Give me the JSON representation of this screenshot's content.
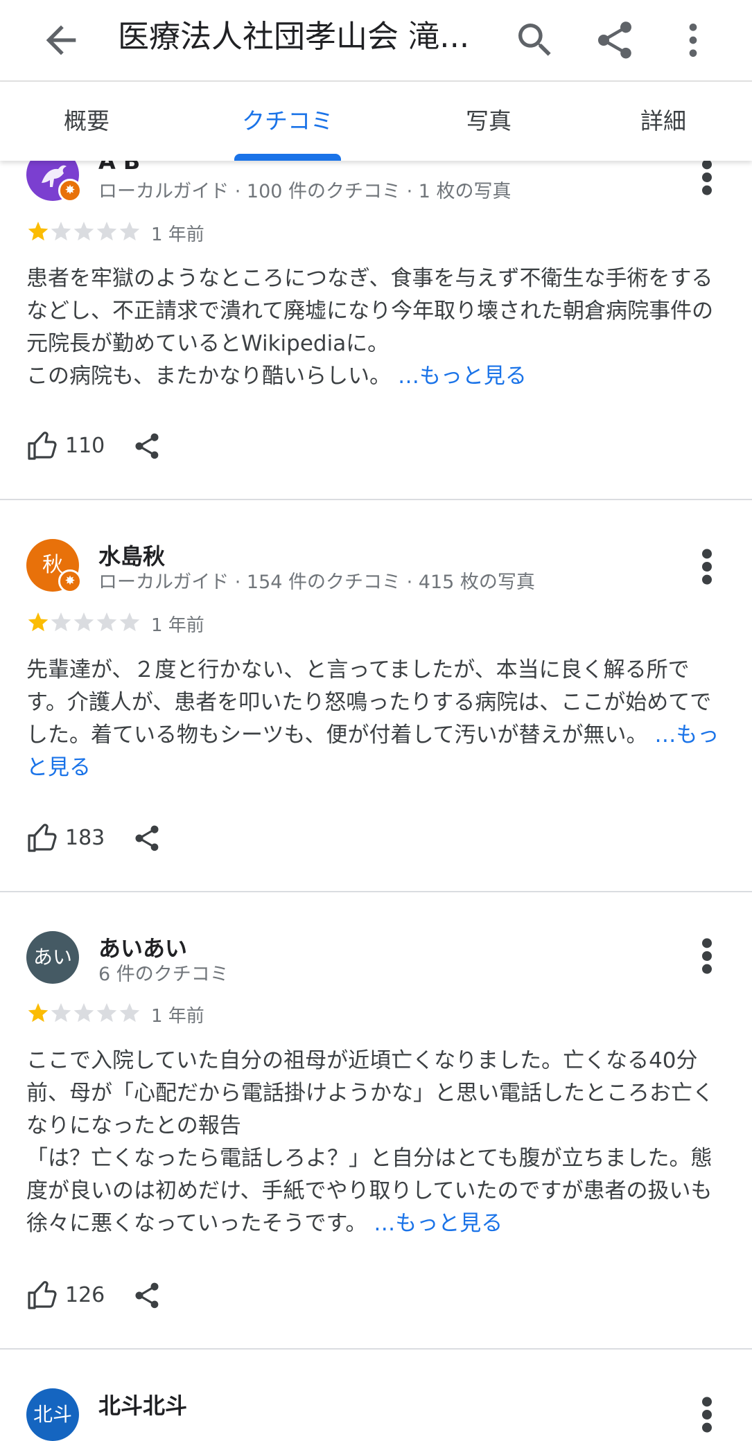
{
  "appbar": {
    "title": "医療法人社団孝山会 滝...",
    "back_icon": "arrow-back-icon",
    "search_icon": "search-icon",
    "share_icon": "share-icon",
    "more_icon": "more-vert-icon"
  },
  "tabs": [
    {
      "label": "概要",
      "active": false
    },
    {
      "label": "クチコミ",
      "active": true
    },
    {
      "label": "写真",
      "active": false
    },
    {
      "label": "詳細",
      "active": false
    }
  ],
  "colors": {
    "accent": "#1a73e8",
    "star": "#fbbc04",
    "star_empty": "#dadce0"
  },
  "reviews": [
    {
      "name": "A B",
      "meta": "ローカルガイド · 100 件のクチコミ · 1 枚の写真",
      "rating": 1,
      "rating_max": 5,
      "time": "1 年前",
      "body": "患者を牢獄のようなところにつなぎ、食事を与えず不衛生な手術をするなどし、不正請求で潰れて廃墟になり今年取り壊された朝倉病院事件の元院長が勤めているとWikipediaに。\nこの病院も、またかなり酷いらしい。 ",
      "more_label": "…もっと見る",
      "likes": "110",
      "avatar_text": "",
      "avatar_color": "#7b3fd0"
    },
    {
      "name": "水島秋",
      "meta": "ローカルガイド · 154 件のクチコミ · 415 枚の写真",
      "rating": 1,
      "rating_max": 5,
      "time": "1 年前",
      "body": "先輩達が、２度と行かない、と言ってましたが、本当に良く解る所です。介護人が、患者を叩いたり怒鳴ったりする病院は、ここが始めてでした。着ている物もシーツも、便が付着して汚いが替えが無い。 ",
      "more_label": "…もっと見る",
      "likes": "183",
      "avatar_text": "秋",
      "avatar_color": "#e8710a"
    },
    {
      "name": "あいあい",
      "meta": "6 件のクチコミ",
      "rating": 1,
      "rating_max": 5,
      "time": "1 年前",
      "body": "ここで入院していた自分の祖母が近頃亡くなりました。亡くなる40分前、母が「心配だから電話掛けようかな」と思い電話したところお亡くなりになったとの報告\n「は？亡くなったら電話しろよ？」と自分はとても腹が立ちました。態度が良いのは初めだけ、手紙でやり取りしていたのですが患者の扱いも徐々に悪くなっていったそうです。 ",
      "more_label": "…もっと見る",
      "likes": "126",
      "avatar_text": "あい",
      "avatar_color": "#455a64"
    },
    {
      "name": "北斗北斗",
      "avatar_text": "北斗",
      "avatar_color": "#1565c0"
    }
  ]
}
